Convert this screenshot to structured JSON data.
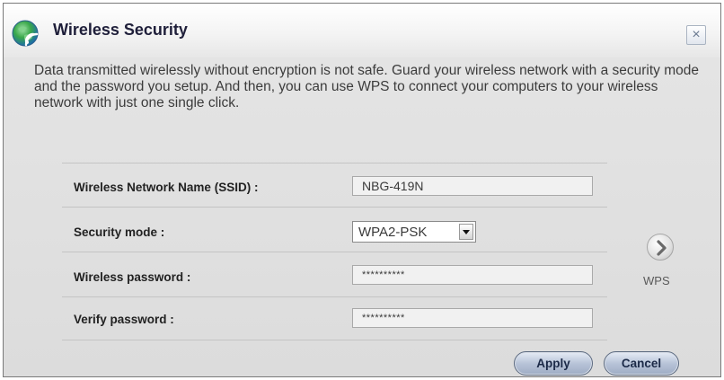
{
  "dialog": {
    "title": "Wireless Security",
    "close_symbol": "×",
    "description": "Data transmitted wirelessly without encryption is not safe. Guard your wireless network with a security mode and the password you setup. And then, you can use WPS to connect your computers to your wireless network with just one single click."
  },
  "form": {
    "ssid_label": "Wireless Network Name (SSID) :",
    "ssid_value": "NBG-419N",
    "security_mode_label": "Security mode :",
    "security_mode_value": "WPA2-PSK",
    "wireless_password_label": "Wireless password :",
    "wireless_password_value": "**********",
    "verify_password_label": "Verify password :",
    "verify_password_value": "**********"
  },
  "wps": {
    "label": "WPS",
    "icon": "chevron-right-icon"
  },
  "buttons": {
    "apply_label": "Apply",
    "cancel_label": "Cancel"
  },
  "icons": {
    "title_icon": "wifi-globe-icon",
    "close_icon": "close-icon",
    "dropdown_icon": "chevron-down-icon"
  },
  "colors": {
    "title": "#1f1f3a",
    "dialog_background": "#dedede",
    "button_blue": "#b8c4d8",
    "icon_green": "#2f9a3e",
    "icon_blue": "#2a68b0"
  }
}
